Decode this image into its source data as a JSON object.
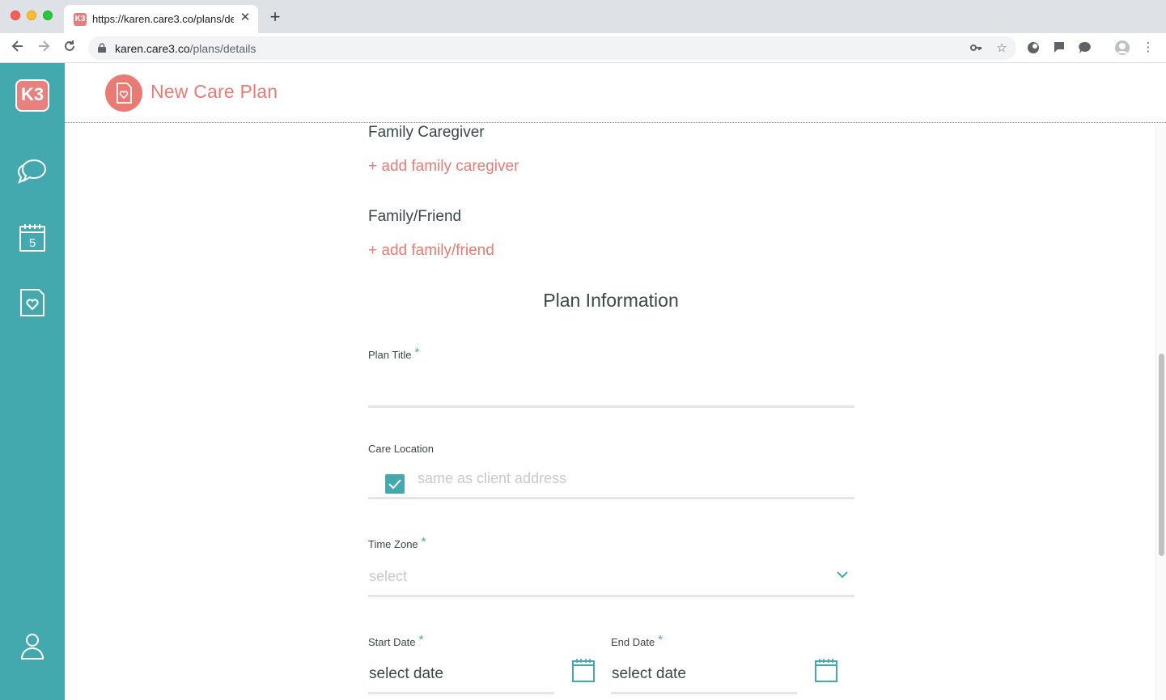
{
  "browser": {
    "tab_title": "https://karen.care3.co/plans/details",
    "favicon_text": "K3",
    "url_host": "karen.care3.co",
    "url_path": "/plans/details"
  },
  "app": {
    "logo_text": "K3",
    "page_title": "New Care Plan",
    "accent_color": "#43a9ae",
    "brand_color": "#ea7a74"
  },
  "form": {
    "family_caregiver_label": "Family Caregiver",
    "add_family_caregiver": "+ add family caregiver",
    "family_friend_label": "Family/Friend",
    "add_family_friend": "+ add family/friend",
    "plan_info_heading": "Plan Information",
    "plan_title_label": "Plan Title",
    "plan_title_value": "",
    "care_location_label": "Care Location",
    "care_location_placeholder": "same as client address",
    "care_location_checked": true,
    "time_zone_label": "Time Zone",
    "time_zone_placeholder": "select",
    "start_date_label": "Start Date",
    "start_date_value": "select date",
    "end_date_label": "End Date",
    "end_date_value": "select date",
    "required_mark": "*"
  }
}
